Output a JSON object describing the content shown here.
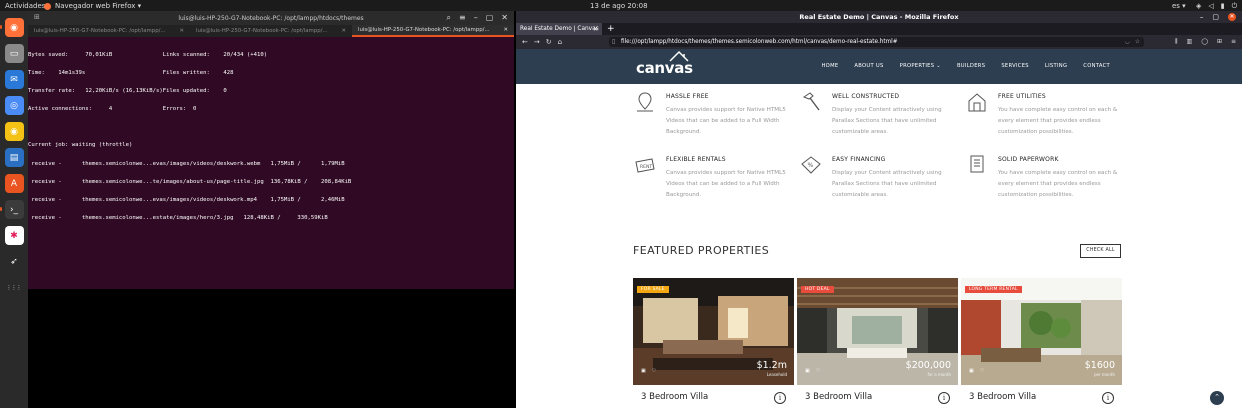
{
  "topbar": {
    "activities": "Actividades",
    "firefox_menu": "Navegador web Firefox ▾",
    "clock": "13 de ago  20:08",
    "lang": "es ▾"
  },
  "dock": [
    {
      "name": "firefox",
      "color": "#ff7139",
      "glyph": "◉",
      "active": true
    },
    {
      "name": "files",
      "color": "#8a8a8a",
      "glyph": "▭",
      "active": false
    },
    {
      "name": "thunderbird",
      "color": "#2a78d7",
      "glyph": "✉",
      "active": false
    },
    {
      "name": "chromium",
      "color": "#4b8bf5",
      "glyph": "◎",
      "active": false
    },
    {
      "name": "rhythmbox",
      "color": "#f3c215",
      "glyph": "◉",
      "active": false
    },
    {
      "name": "libreoffice-writer",
      "color": "#2a6fc1",
      "glyph": "▤",
      "active": false
    },
    {
      "name": "software-center",
      "color": "#e95420",
      "glyph": "A",
      "active": false
    },
    {
      "name": "terminal",
      "color": "#3b3b3b",
      "glyph": "›_",
      "active": true
    },
    {
      "name": "slack",
      "color": "#ffffff",
      "glyph": "✱",
      "active": false
    },
    {
      "name": "postman",
      "color": "#2a2a2a",
      "glyph": "➶",
      "active": false
    },
    {
      "name": "app-grid",
      "color": "#2a2a2a",
      "glyph": "⋮⋮⋮",
      "active": false
    }
  ],
  "terminal": {
    "title": "luis@luis-HP-250-G7-Notebook-PC: /opt/lampp/htdocs/themes",
    "tabs": [
      "luis@luis-HP-250-G7-Notebook-PC: /opt/lampp/...",
      "luis@luis-HP-250-G7-Notebook-PC: /opt/lampp/...",
      "luis@luis-HP-250-G7-Notebook-PC: /opt/lampp/..."
    ],
    "lines": [
      "Bytes saved:     70,01KiB               Links scanned:    20/434 (+410)",
      "Time:    14m1s39s                       Files written:    428",
      "Transfer rate:   12,20KiB/s (16,13KiB/s)Files updated:    0",
      "Active connections:     4               Errors:  0",
      "",
      "Current job: waiting (throttle)",
      " receive -      themes.semicolonwe...evas/images/videos/deskwork.webm   1,75MiB /      1,79MiB",
      " receive -      themes.semicolonwe...te/images/about-us/page-title.jpg  136,78KiB /    208,84KiB",
      " receive -      themes.semicolonwe...evas/images/videos/deskwork.mp4    1,75MiB /      2,46MiB",
      " receive -      themes.semicolonwe...estate/images/hero/3.jpg   128,48KiB /     330,59KiB"
    ]
  },
  "browser": {
    "window_title": "Real Estate Demo | Canvas - Mozilla Firefox",
    "tab_title": "Real Estate Demo | Canvas",
    "url": "file:///opt/lampp/htdocs/themes/themes.semicolonweb.com/html/canvas/demo-real-estate.html#"
  },
  "site": {
    "logo": "canvas",
    "menu": [
      "HOME",
      "ABOUT US",
      "PROPERTIES ⌄",
      "BUILDERS",
      "SERVICES",
      "LISTING",
      "CONTACT"
    ],
    "features": [
      {
        "title": "HASSLE FREE",
        "text": "Canvas provides support for Native HTML5 Videos that can be added to a Full Width Background.",
        "icon": "map-pin-icon"
      },
      {
        "title": "WELL CONSTRUCTED",
        "text": "Display your Content attractively using Parallax Sections that have unlimited customizable areas.",
        "icon": "hammer-icon"
      },
      {
        "title": "FREE UTILITIES",
        "text": "You have complete easy control on each & every element that provides endless customization possibilities.",
        "icon": "house-icon"
      },
      {
        "title": "FLEXIBLE RENTALS",
        "text": "Canvas provides support for Native HTML5 Videos that can be added to a Full Width Background.",
        "icon": "rent-sign-icon"
      },
      {
        "title": "EASY FINANCING",
        "text": "Display your Content attractively using Parallax Sections that have unlimited customizable areas.",
        "icon": "percent-house-icon"
      },
      {
        "title": "SOLID PAPERWORK",
        "text": "You have complete easy control on each & every element that provides endless customization possibilities.",
        "icon": "document-icon"
      }
    ],
    "featured_title": "FEATURED PROPERTIES",
    "check_all": "CHECK ALL",
    "cards": [
      {
        "badge": "FOR SALE",
        "badge_color": "#f3a712",
        "price": "$1.2m",
        "price_sub": "Leasehold",
        "title": "3 Bedroom Villa"
      },
      {
        "badge": "HOT DEAL",
        "badge_color": "#e74c3c",
        "price": "$200,000",
        "price_sub": "for a month",
        "title": "3 Bedroom Villa"
      },
      {
        "badge": "LONG TERM RENTAL",
        "badge_color": "#e74c3c",
        "price": "$1600",
        "price_sub": "per month",
        "title": "3 Bedroom Villa"
      }
    ]
  },
  "colors": {
    "header": "#2c3e50",
    "terminal_bg": "#300a24",
    "ubuntu_orange": "#e95420"
  }
}
